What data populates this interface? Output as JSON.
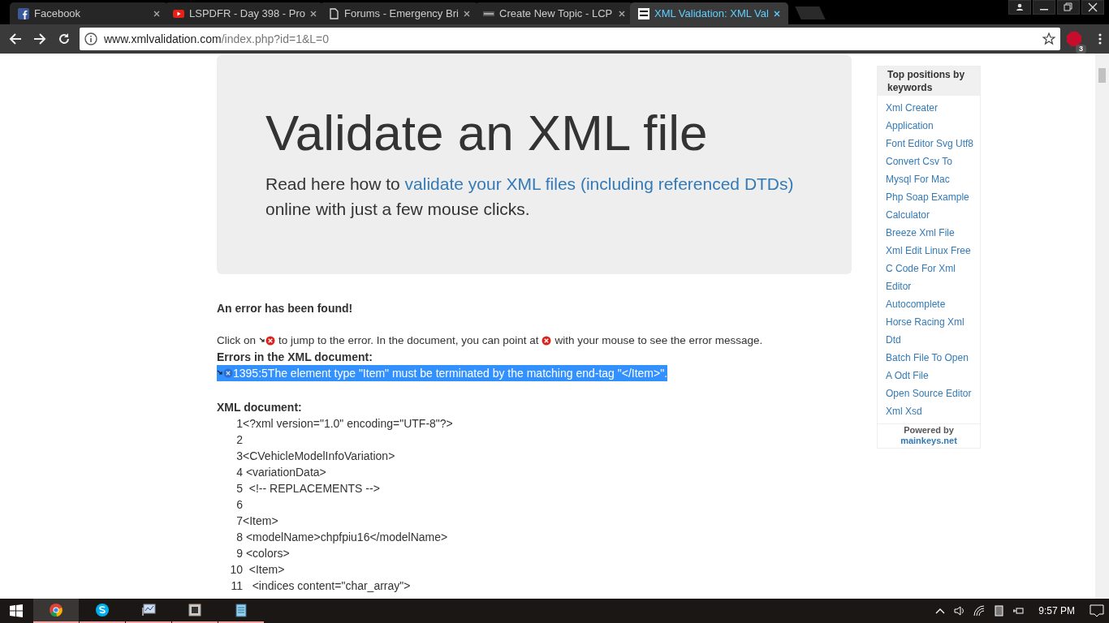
{
  "tabs": [
    {
      "title": "Facebook",
      "selected": false
    },
    {
      "title": "LSPDFR - Day 398 - Pro",
      "selected": false
    },
    {
      "title": "Forums - Emergency Bri",
      "selected": false
    },
    {
      "title": "Create New Topic - LCP",
      "selected": false
    },
    {
      "title": "XML Validation: XML Val",
      "selected": true
    }
  ],
  "address": {
    "host": "www.xmlvalidation.com",
    "path": "/index.php?id=1&L=0"
  },
  "extension_badge": "3",
  "hero": {
    "title": "Validate an XML file",
    "lead_before": "Read here how to",
    "lead_link": "validate your XML files (including referenced DTDs)",
    "lead_after": "online with just a few mouse clicks."
  },
  "error_heading": "An error has been found!",
  "instruction": [
    "Click on",
    "to jump to the error. In the document, you can point at",
    "with your mouse to see the error message."
  ],
  "errors_heading": "Errors in the XML document:",
  "errors": [
    {
      "position": "1395:5",
      "message": "The element type \"Item\" must be terminated by the matching end-tag \"</Item>\".",
      "selected": true
    }
  ],
  "document_heading": "XML document:",
  "lines": [
    {
      "number": "1",
      "code": "<?xml version=\"1.0\" encoding=\"UTF-8\"?>"
    },
    {
      "number": "2"
    },
    {
      "number": "3",
      "code": "<CVehicleModelInfoVariation>"
    },
    {
      "number": "4",
      "code": " <variationData>"
    },
    {
      "number": "5",
      "code": "  <!-- REPLACEMENTS -->"
    },
    {
      "number": "6"
    },
    {
      "number": "7",
      "code": "<Item>"
    },
    {
      "number": "8",
      "code": " <modelName>chpfpiu16</modelName>"
    },
    {
      "number": "9",
      "code": " <colors>"
    },
    {
      "number": "10",
      "code": "  <Item>"
    },
    {
      "number": "11",
      "code": "   <indices content=\"char_array\">"
    }
  ],
  "sidebar": {
    "title": "Top positions by keywords",
    "links": [
      "Xml Creater",
      "Application",
      "Font Editor Svg Utf8",
      "Convert Csv To",
      "Mysql For Mac",
      "Php Soap Example",
      "Calculator",
      "Breeze Xml File",
      "Xml Edit Linux Free",
      "C Code For Xml",
      "Editor",
      "Autocomplete",
      "Horse Racing Xml",
      "Dtd",
      "Batch File To Open",
      "A Odt File",
      "Open Source Editor",
      "Xml Xsd"
    ],
    "powered_by": "Powered by",
    "powered_link": "mainkeys.net"
  },
  "taskbar": {
    "apps": [
      {
        "active": true
      },
      {
        "active": false
      },
      {
        "active": false
      },
      {
        "active": false
      },
      {
        "active": false
      }
    ],
    "time": "9:57 PM"
  }
}
